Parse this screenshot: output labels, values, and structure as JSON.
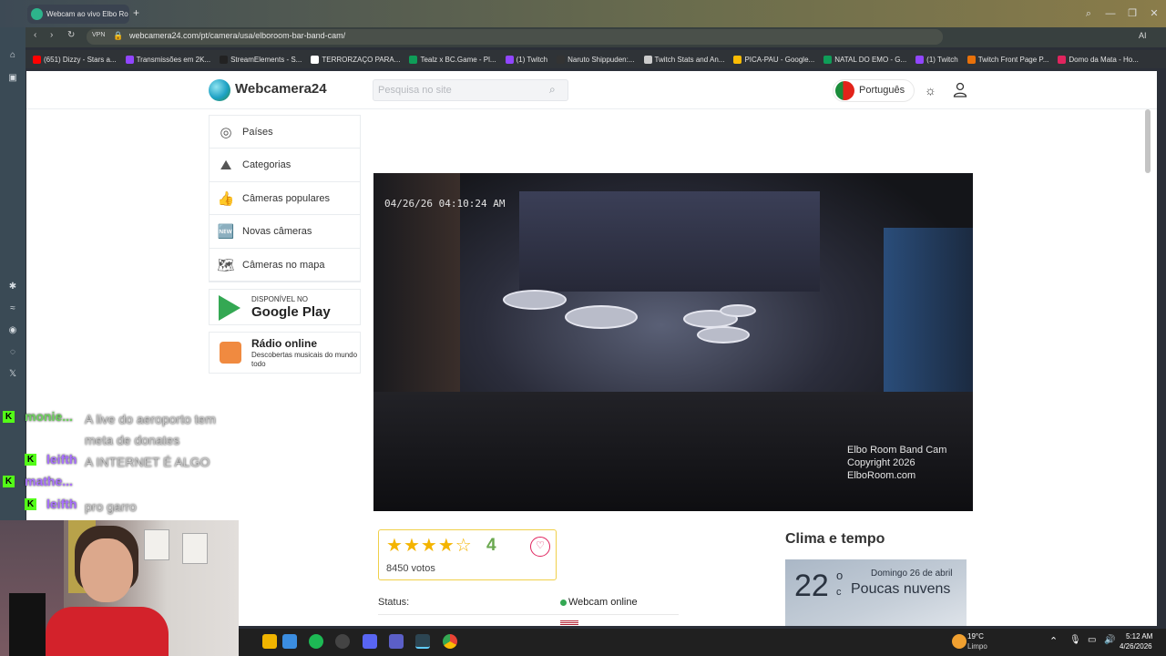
{
  "browser": {
    "tab_title": "Webcam ao vivo Elbo Ro",
    "url": "webcamera24.com/pt/camera/usa/elboroom-bar-band-cam/",
    "vpn_label": "VPN",
    "ai_label": "AI",
    "bookmarks": [
      {
        "label": "(651) Dizzy - Stars a...",
        "color": "#ff0000"
      },
      {
        "label": "Transmissões em 2K...",
        "color": "#9146ff"
      },
      {
        "label": "StreamElements - S...",
        "color": "#222222"
      },
      {
        "label": "TERRORZAÇO PARA...",
        "color": "#ffffff"
      },
      {
        "label": "Tealz x BC.Game - Pl...",
        "color": "#0f9d58"
      },
      {
        "label": "(1) Twitch",
        "color": "#9146ff"
      },
      {
        "label": "Naruto Shippuden:...",
        "color": "#333333"
      },
      {
        "label": "Twitch Stats and An...",
        "color": "#cccccc"
      },
      {
        "label": "PICA-PAU - Google...",
        "color": "#fbbc04"
      },
      {
        "label": "NATAL DO EMO - G...",
        "color": "#0f9d58"
      },
      {
        "label": "(1) Twitch",
        "color": "#9146ff"
      },
      {
        "label": "Twitch Front Page P...",
        "color": "#e8710a"
      },
      {
        "label": "Domo da Mata - Ho...",
        "color": "#e0245e"
      }
    ]
  },
  "site": {
    "logo": "Webcamera24",
    "search_placeholder": "Pesquisa no site",
    "language": "Português",
    "menu": [
      {
        "label": "Países",
        "icon": "globe-icon",
        "glyph": "◎"
      },
      {
        "label": "Categorias",
        "icon": "landscape-icon",
        "glyph": "⛰"
      },
      {
        "label": "Câmeras populares",
        "icon": "thumbs-up-icon",
        "glyph": "👍"
      },
      {
        "label": "Novas câmeras",
        "icon": "new-badge-icon",
        "glyph": "🆕"
      },
      {
        "label": "Câmeras no mapa",
        "icon": "map-icon",
        "glyph": "🗺"
      }
    ],
    "google_play": {
      "small": "DISPONÍVEL NO",
      "big": "Google Play"
    },
    "radio": {
      "title": "Rádio online",
      "subtitle": "Descobertas musicais do mundo todo"
    }
  },
  "camera": {
    "timestamp": "04/26/26 04:10:24 AM",
    "watermark": [
      "Elbo Room Band Cam",
      "Copyright 2026",
      "ElboRoom.com"
    ],
    "rating": "4",
    "stars_filled": 4,
    "stars_total": 5,
    "votes": "8450 votos",
    "status_label": "Status:",
    "status_value": "Webcam online"
  },
  "weather": {
    "title": "Clima e tempo",
    "temp": "22",
    "deg": "o",
    "unit": "c",
    "date": "Domingo 26 de abril",
    "desc": "Poucas nuvens"
  },
  "chat": [
    {
      "user": "monie...",
      "msg": "A live do aeroporto tem meta de donates",
      "color": "#6ed25e"
    },
    {
      "user": "leifth",
      "msg": "A INTERNET É ALGO",
      "color": "#a970ff"
    },
    {
      "user": "mathe...",
      "msg": "",
      "color": "#a970ff"
    },
    {
      "user": "leifth",
      "msg": "pro garro",
      "color": "#a970ff"
    }
  ],
  "taskbar": {
    "weather_temp": "19°C",
    "weather_desc": "Limpo",
    "time": "5:12 AM",
    "date": "4/26/2026"
  }
}
